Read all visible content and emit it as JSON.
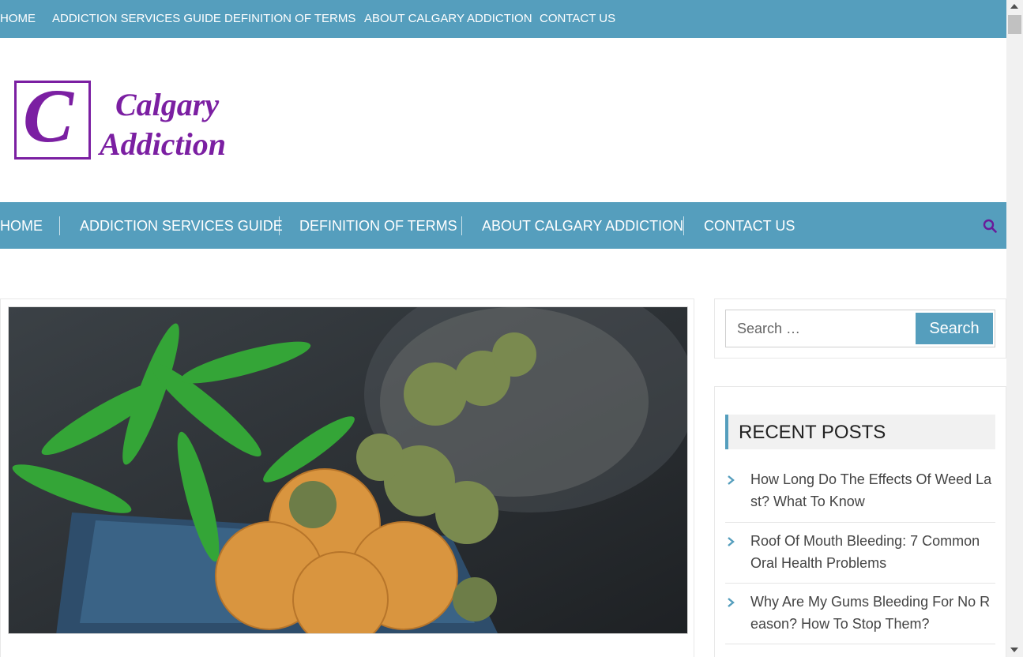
{
  "top_nav": [
    "HOME",
    "ADDICTION SERVICES GUIDE",
    "DEFINITION OF TERMS",
    "ABOUT CALGARY ADDICTION",
    "CONTACT US"
  ],
  "logo": {
    "letter": "C",
    "line1": "Calgary",
    "line2": "Addiction"
  },
  "main_nav": [
    "HOME",
    "ADDICTION SERVICES GUIDE",
    "DEFINITION OF TERMS",
    "ABOUT CALGARY ADDICTION",
    "CONTACT US"
  ],
  "search": {
    "placeholder": "Search …",
    "button": "Search"
  },
  "recent_posts": {
    "title": "RECENT POSTS",
    "items": [
      "How Long Do The Effects Of Weed Last? What To Know",
      "Roof Of Mouth Bleeding: 7 Common Oral Health Problems",
      "Why Are My Gums Bleeding For No Reason? How To Stop Them?"
    ]
  },
  "colors": {
    "accent": "#559ebd",
    "brand": "#7b1fa2"
  }
}
